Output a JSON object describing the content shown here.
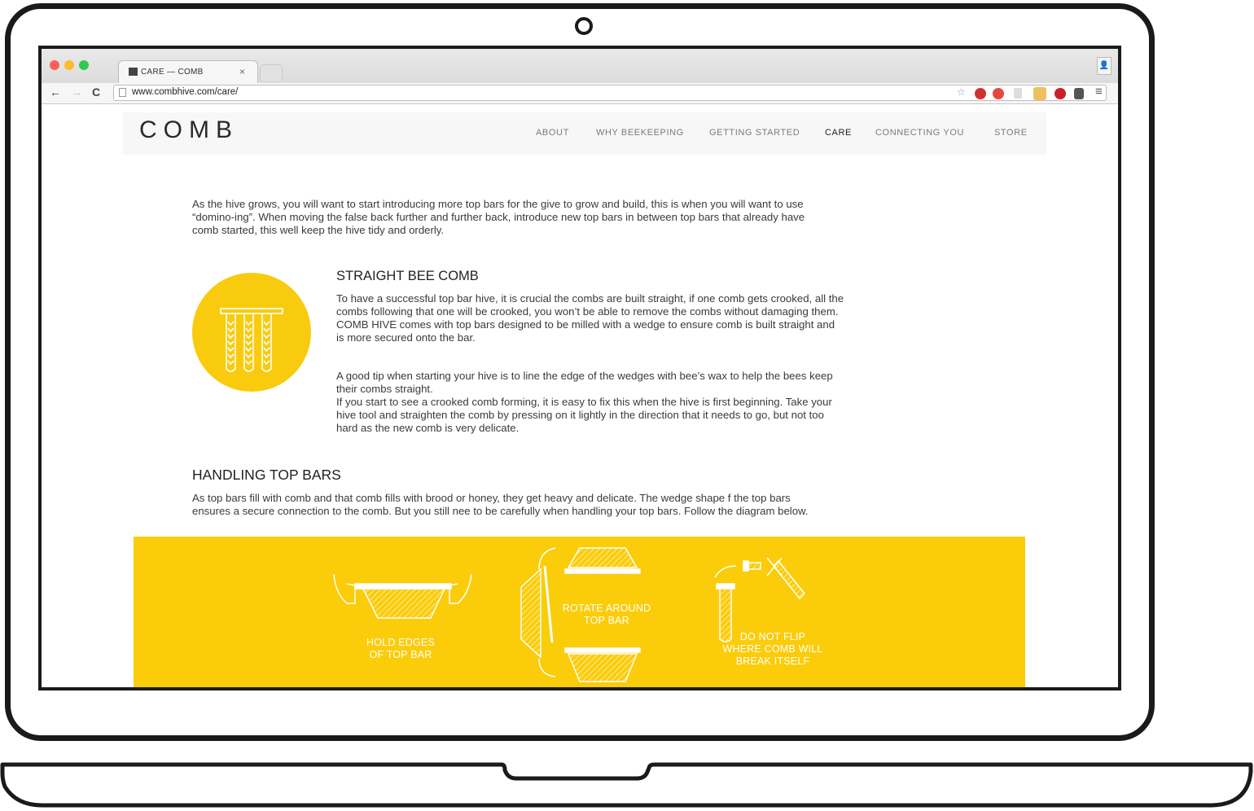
{
  "browser": {
    "tab_title": "CARE — COMB",
    "tab_close": "×",
    "url": "www.combhive.com/care/",
    "back": "←",
    "forward": "→",
    "reload": "C",
    "menu": "≡",
    "star": "☆",
    "profile": "👤"
  },
  "site": {
    "logo": "COMB",
    "nav": [
      "ABOUT",
      "WHY BEEKEEPING",
      "GETTING STARTED",
      "CARE",
      "CONNECTING YOU",
      "STORE"
    ],
    "active_nav": "CARE"
  },
  "content": {
    "intro": [
      "As the hive grows, you will want to start introducing more top bars for the give to grow and build, this is when you will want to use",
      "“domino-ing”. When moving the false back further and further back, introduce new top bars in between top bars that already have",
      "comb started, this well keep the hive tidy and orderly."
    ],
    "straight_heading": "STRAIGHT BEE COMB",
    "straight_p1": [
      "To have a successful top bar hive, it is crucial the combs are built straight, if one comb gets crooked, all the",
      "combs following that one will be crooked, you won’t be able to remove the combs without damaging them.",
      "COMB HIVE comes with top bars designed to be milled with a wedge to ensure comb is built straight and",
      "is more secured onto the bar."
    ],
    "straight_p2": [
      "A good tip when starting your hive is to line the edge of the wedges with bee’s wax to help the bees keep",
      "their combs straight.",
      "If you start to see a crooked comb forming, it is easy to fix this when the hive is first beginning. Take your",
      "hive tool and straighten the comb by pressing on it  lightly in the direction that it needs to go, but not too",
      "hard as the new comb is very delicate."
    ],
    "handling_heading": "HANDLING TOP BARS",
    "handling_p": [
      "As top bars fill with comb and that comb fills with brood or honey, they get heavy and delicate. The wedge shape f the top bars",
      "ensures a secure connection to the comb. But you still nee to be carefully when handling your top bars. Follow the diagram below."
    ]
  },
  "diagram": {
    "step1": [
      "HOLD EDGES",
      "OF TOP BAR"
    ],
    "step2": [
      "ROTATE AROUND",
      "TOP BAR"
    ],
    "step3": [
      "DO NOT FLIP",
      "WHERE COMB WILL",
      "BREAK ITSELF"
    ]
  },
  "colors": {
    "accent_yellow": "#fbcc0a",
    "frame": "#1a1a1a",
    "tl_red": "#fc5f57",
    "tl_yellow": "#fdbc2e",
    "tl_green": "#34c84a"
  }
}
